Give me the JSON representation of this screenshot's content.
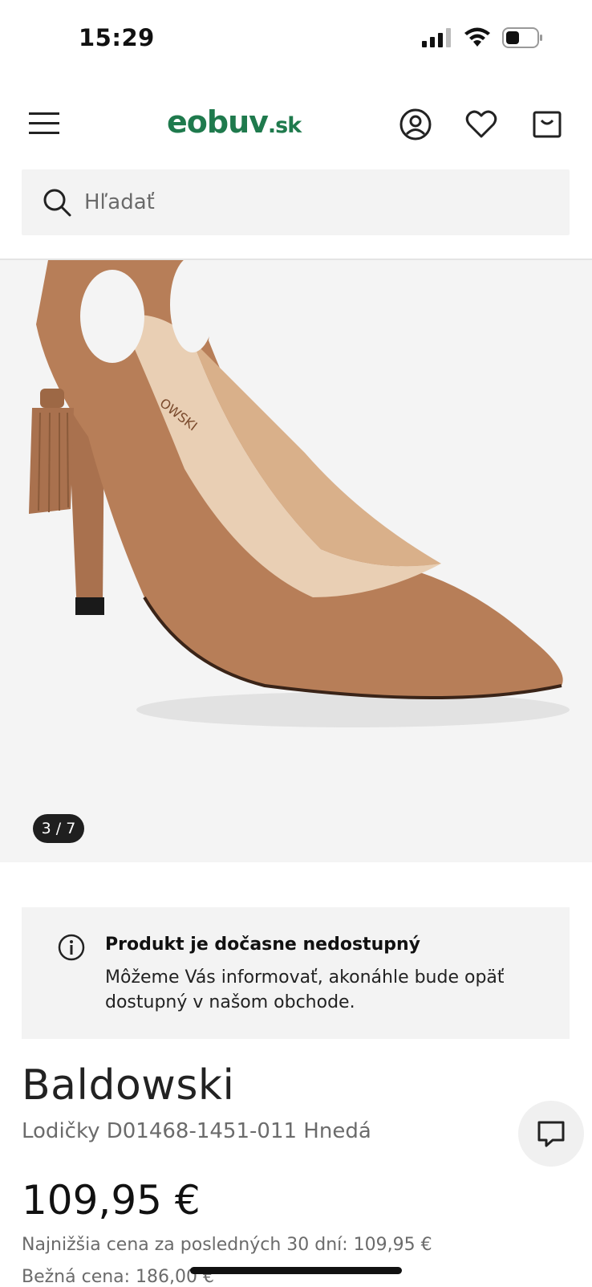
{
  "status_bar": {
    "time": "15:29"
  },
  "header": {
    "logo_main": "eobuv",
    "logo_tld": ".sk",
    "icons": [
      "menu-icon",
      "account-icon",
      "heart-icon",
      "bag-icon"
    ]
  },
  "search": {
    "placeholder": "Hľadať"
  },
  "gallery": {
    "counter": "3 / 7",
    "image_subject": "brown suede pointed-toe pump with tassel",
    "insole_text": "OWSKI"
  },
  "notice": {
    "title": "Produkt je dočasne nedostupný",
    "text": "Môžeme Vás informovať, akonáhle bude opäť dostupný v našom obchode."
  },
  "product": {
    "brand": "Baldowski",
    "name": "Lodičky D01468-1451-011 Hnedá",
    "price": "109,95 €",
    "lowest_price": "Najnižšia cena za posledných 30 dní: 109,95 €",
    "regular_price": "Bežná cena: 186,00 €"
  },
  "colors": {
    "brand_green": "#1f7a4d",
    "shoe_tan": "#b77e58"
  }
}
